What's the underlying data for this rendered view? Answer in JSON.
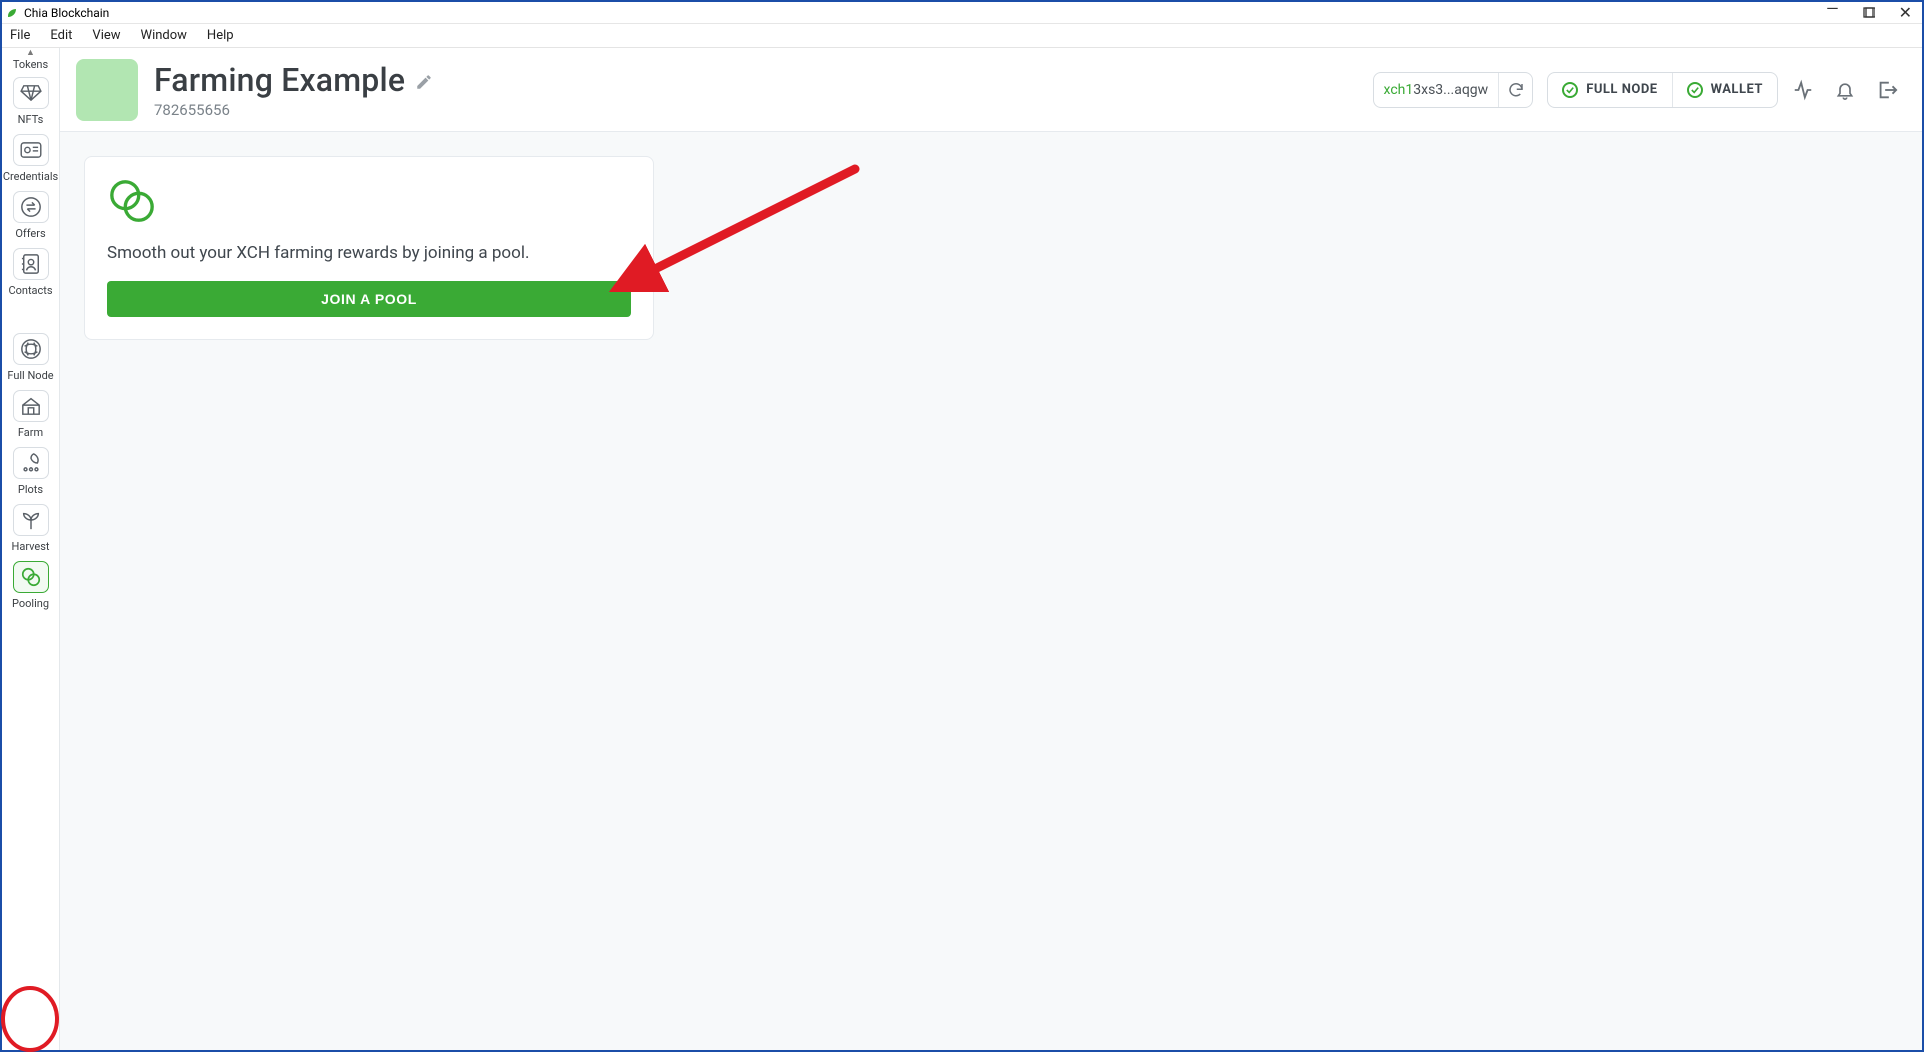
{
  "window": {
    "title": "Chia Blockchain"
  },
  "menubar": {
    "items": [
      "File",
      "Edit",
      "View",
      "Window",
      "Help"
    ]
  },
  "sidebar": {
    "items": [
      {
        "id": "tokens",
        "label": "Tokens",
        "icon": "tokens-icon"
      },
      {
        "id": "nfts",
        "label": "NFTs",
        "icon": "diamond-icon"
      },
      {
        "id": "credentials",
        "label": "Credentials",
        "icon": "id-card-icon"
      },
      {
        "id": "offers",
        "label": "Offers",
        "icon": "swap-icon"
      },
      {
        "id": "contacts",
        "label": "Contacts",
        "icon": "contacts-icon"
      },
      {
        "id": "fullnode",
        "label": "Full Node",
        "icon": "node-icon"
      },
      {
        "id": "farm",
        "label": "Farm",
        "icon": "barn-icon"
      },
      {
        "id": "plots",
        "label": "Plots",
        "icon": "leafdots-icon"
      },
      {
        "id": "harvest",
        "label": "Harvest",
        "icon": "sprout-icon"
      },
      {
        "id": "pooling",
        "label": "Pooling",
        "icon": "pooling-icon",
        "active": true
      }
    ]
  },
  "header": {
    "title": "Farming Example",
    "subtitle": "782655656",
    "address_prefix": "xch1",
    "address_rest": "3xs3...aqgw",
    "status": {
      "fullnode": "FULL NODE",
      "wallet": "WALLET"
    }
  },
  "card": {
    "text": "Smooth out your XCH farming rewards by joining a pool.",
    "button": "JOIN A POOL"
  },
  "colors": {
    "accent_green": "#3aaa35",
    "window_border": "#1b4ea8",
    "annotation_red": "#e01b24"
  }
}
